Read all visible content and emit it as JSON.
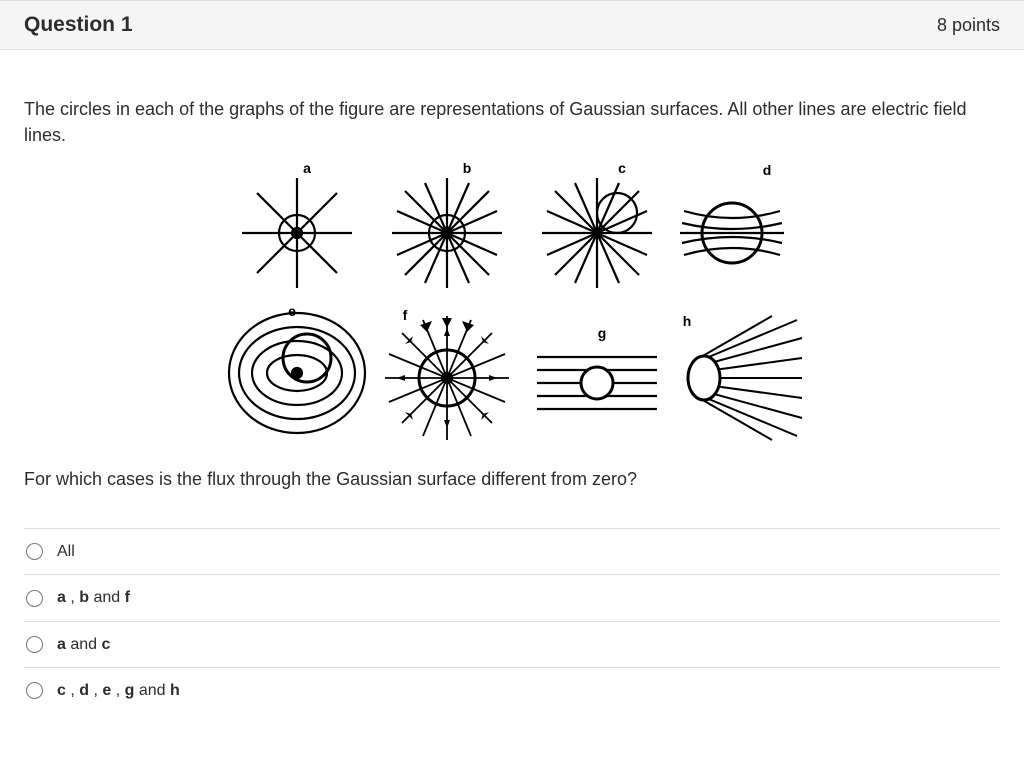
{
  "header": {
    "title": "Question 1",
    "points": "8 points"
  },
  "question": {
    "stem": "The circles in each of the graphs of the figure are representations of Gaussian surfaces. All other lines are electric field lines.",
    "postlude": "For which cases is the flux through the Gaussian surface different from zero?"
  },
  "figure": {
    "labels": [
      "a",
      "b",
      "c",
      "d",
      "e",
      "f",
      "g",
      "h"
    ]
  },
  "options": [
    {
      "id": "opt1",
      "html": "All"
    },
    {
      "id": "opt2",
      "html": "<span class='b'>a</span> , <span class='b'>b</span> and <span class='b'>f</span>"
    },
    {
      "id": "opt3",
      "html": "<span class='b'>a</span> and <span class='b'>c</span>"
    },
    {
      "id": "opt4",
      "html": "<span class='b'>c</span> , <span class='b'>d</span> , <span class='b'>e</span> , <span class='b'>g</span> and <span class='b'>h</span>"
    }
  ]
}
